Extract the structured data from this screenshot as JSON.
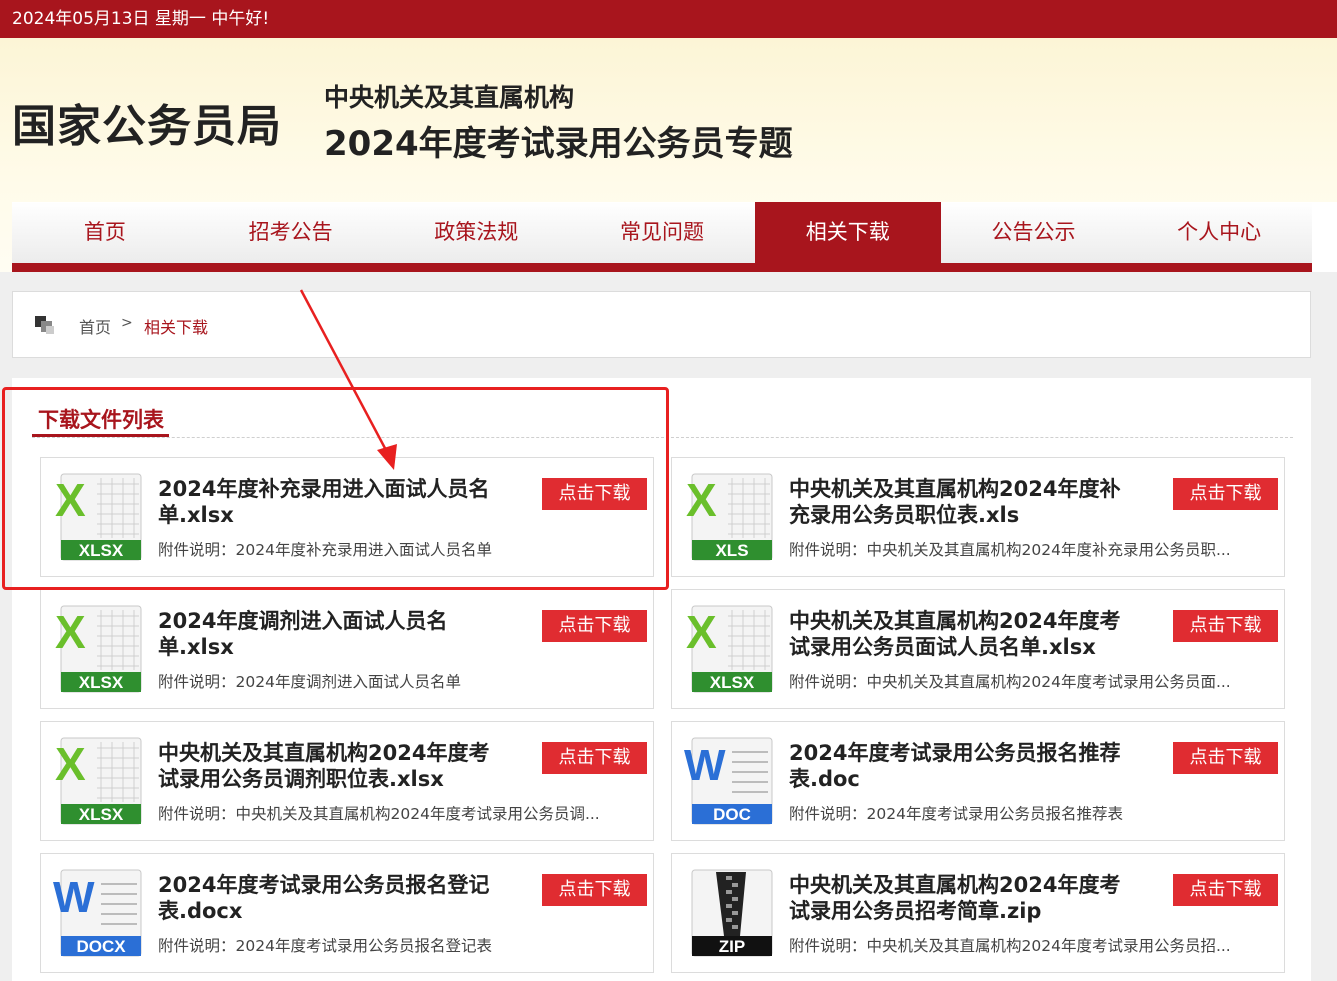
{
  "topbar": {
    "greeting": "2024年05月13日   星期一   中午好!"
  },
  "header": {
    "logo": "国家公务员局",
    "subtitle_line1": "中央机关及其直属机构",
    "subtitle_line2": "2024年度考试录用公务员专题"
  },
  "nav": {
    "items": [
      "首页",
      "招考公告",
      "政策法规",
      "常见问题",
      "相关下载",
      "公告公示",
      "个人中心"
    ],
    "active": "相关下载"
  },
  "breadcrumb": {
    "home": "首页",
    "separator": ">",
    "current": "相关下载"
  },
  "panel": {
    "title": "下载文件列表"
  },
  "files": [
    {
      "type": "XLSX",
      "name": "2024年度补充录用进入面试人员名单.xlsx",
      "desc": "附件说明：2024年度补充录用进入面试人员名单",
      "button": "点击下载"
    },
    {
      "type": "XLS",
      "name": "中央机关及其直属机构2024年度补充录用公务员职位表.xls",
      "desc": "附件说明：中央机关及其直属机构2024年度补充录用公务员职...",
      "button": "点击下载"
    },
    {
      "type": "XLSX",
      "name": "2024年度调剂进入面试人员名单.xlsx",
      "desc": "附件说明：2024年度调剂进入面试人员名单",
      "button": "点击下载"
    },
    {
      "type": "XLSX",
      "name": "中央机关及其直属机构2024年度考试录用公务员面试人员名单.xlsx",
      "desc": "附件说明：中央机关及其直属机构2024年度考试录用公务员面...",
      "button": "点击下载"
    },
    {
      "type": "XLSX",
      "name": "中央机关及其直属机构2024年度考试录用公务员调剂职位表.xlsx",
      "desc": "附件说明：中央机关及其直属机构2024年度考试录用公务员调...",
      "button": "点击下载"
    },
    {
      "type": "DOC",
      "name": "2024年度考试录用公务员报名推荐表.doc",
      "desc": "附件说明：2024年度考试录用公务员报名推荐表",
      "button": "点击下载"
    },
    {
      "type": "DOCX",
      "name": "2024年度考试录用公务员报名登记表.docx",
      "desc": "附件说明：2024年度考试录用公务员报名登记表",
      "button": "点击下载"
    },
    {
      "type": "ZIP",
      "name": "中央机关及其直属机构2024年度考试录用公务员招考简章.zip",
      "desc": "附件说明：中央机关及其直属机构2024年度考试录用公务员招...",
      "button": "点击下载"
    }
  ],
  "colors": {
    "brand": "#a8151d",
    "button": "#e02c31",
    "excel": "#2f8f2f",
    "word": "#2b6fd6",
    "zip": "#111111",
    "highlight": "#e82020"
  }
}
